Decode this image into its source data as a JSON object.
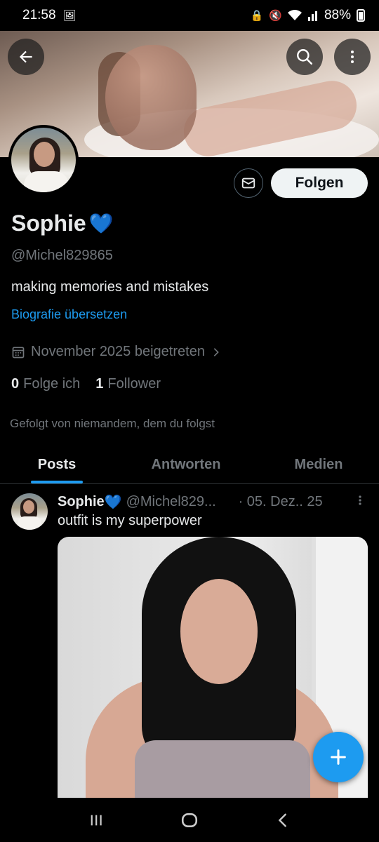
{
  "status_bar": {
    "time": "21:58",
    "battery": "88%"
  },
  "profile": {
    "name": "Sophie",
    "name_emoji": "💙",
    "handle": "@Michel829865",
    "bio": "making memories and mistakes",
    "translate_label": "Biografie übersetzen",
    "joined": "November 2025 beigetreten",
    "following_count": "0",
    "following_label": "Folge ich",
    "followers_count": "1",
    "followers_label": "Follower",
    "followed_by": "Gefolgt von niemandem, dem du folgst"
  },
  "actions": {
    "follow_label": "Folgen"
  },
  "tabs": [
    {
      "label": "Posts",
      "active": true
    },
    {
      "label": "Antworten",
      "active": false
    },
    {
      "label": "Medien",
      "active": false
    }
  ],
  "post": {
    "name": "Sophie",
    "name_emoji": "💙",
    "handle": "@Michel829...",
    "date": "· 05. Dez.. 25",
    "text": "outfit is my superpower"
  },
  "colors": {
    "accent": "#1d9bf0",
    "background": "#000000",
    "text_primary": "#e7e9ea",
    "text_secondary": "#71767b"
  },
  "icons": [
    "back-arrow-icon",
    "search-icon",
    "more-vertical-icon",
    "mail-icon",
    "calendar-icon",
    "chevron-right-icon",
    "plus-icon",
    "recents-icon",
    "home-icon",
    "back-chevron-icon"
  ]
}
